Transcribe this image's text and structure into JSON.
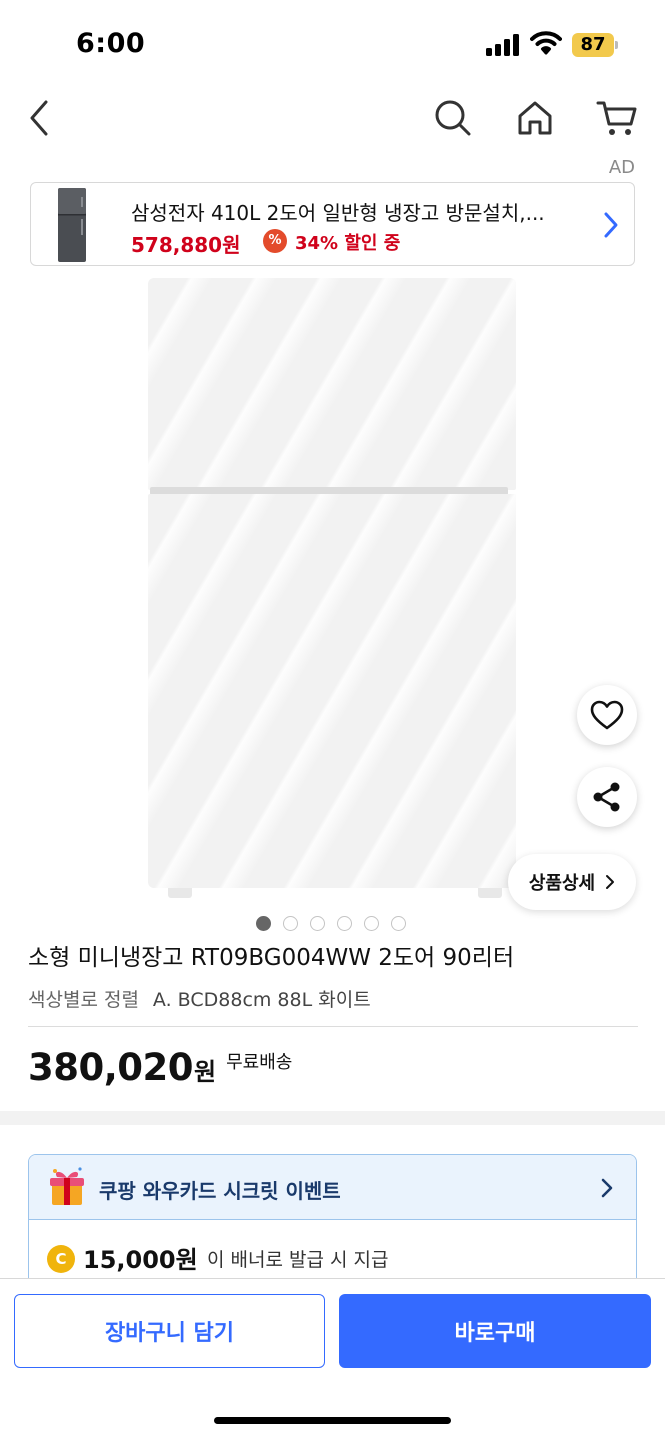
{
  "status_bar": {
    "time": "6:00",
    "battery": "87"
  },
  "nav": {
    "icons": [
      "back-icon",
      "search-icon",
      "home-icon",
      "cart-icon"
    ]
  },
  "ad": {
    "label": "AD",
    "title": "삼성전자 410L 2도어 일반형 냉장고 방문설치,...",
    "price": "578,880원",
    "badge": "%",
    "discount": "34% 할인 중"
  },
  "hero": {
    "detail_label": "상품상세",
    "image_count": 6,
    "active_index": 0
  },
  "product": {
    "title": "소형 미니냉장고 RT09BG004WW 2도어 90리터",
    "option_label": "색상별로 정렬",
    "option_value": "A. BCD88cm 88L 화이트",
    "price": "380,020",
    "currency": "원",
    "shipping": "무료배송"
  },
  "event": {
    "title": "쿠팡 와우카드 시크릿 이벤트",
    "coin_symbol": "C",
    "amount": "15,000원",
    "note": "이 배너로 발급 시 지급"
  },
  "actions": {
    "cart_label": "장바구니 담기",
    "buy_label": "바로구매"
  },
  "colors": {
    "accent": "#346aff",
    "price_red": "#d0021b",
    "event_bg": "#eaf3fd",
    "event_border": "#9cc4ec",
    "battery": "#f2c94c",
    "coin": "#f0b40c"
  }
}
